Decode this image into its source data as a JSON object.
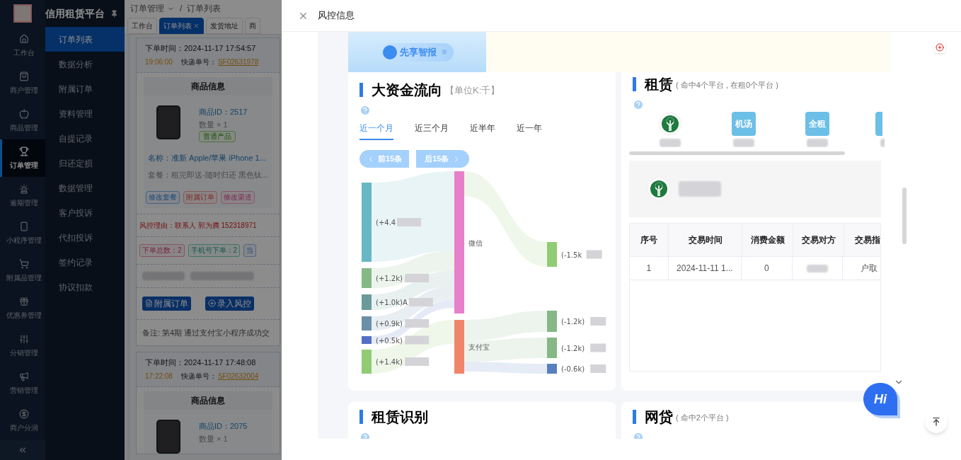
{
  "app": {
    "title": "信用租赁平台"
  },
  "nav": [
    {
      "label": "工作台",
      "selected": false
    },
    {
      "label": "商户管理",
      "selected": false
    },
    {
      "label": "商品管理",
      "selected": false
    },
    {
      "label": "订单管理",
      "selected": true
    },
    {
      "label": "逾期管理",
      "selected": false
    },
    {
      "label": "小程序管理",
      "selected": false
    },
    {
      "label": "附属品管理",
      "selected": false
    },
    {
      "label": "优惠券管理",
      "selected": false
    },
    {
      "label": "分销管理",
      "selected": false
    },
    {
      "label": "营销管理",
      "selected": false
    },
    {
      "label": "商户分润",
      "selected": false
    }
  ],
  "submenu": [
    {
      "label": "订单列表",
      "selected": true
    },
    {
      "label": "数据分析",
      "selected": false
    },
    {
      "label": "附属订单",
      "selected": false
    },
    {
      "label": "资料管理",
      "selected": false
    },
    {
      "label": "自提记录",
      "selected": false
    },
    {
      "label": "归还定损",
      "selected": false
    },
    {
      "label": "数据管理",
      "selected": false
    },
    {
      "label": "客户投诉",
      "selected": false
    },
    {
      "label": "代扣投诉",
      "selected": false
    },
    {
      "label": "签约记录",
      "selected": false
    },
    {
      "label": "协议扣款",
      "selected": false
    }
  ],
  "breadcrumb": {
    "items": [
      "订单管理",
      "订单列表"
    ],
    "separator": "/"
  },
  "tabs": [
    {
      "label": "工作台",
      "selected": false,
      "closable": false
    },
    {
      "label": "订单列表",
      "selected": true,
      "closable": true
    },
    {
      "label": "发货地址",
      "selected": false,
      "closable": false
    },
    {
      "label": "商",
      "selected": false,
      "closable": false
    }
  ],
  "orders": [
    {
      "time_label": "下单时间：",
      "time": "2024-11-17 17:54:57",
      "time2": "19:06:00",
      "express_label": "快递单号：",
      "express": "SF02631978",
      "product_header": "商品信息",
      "product_id": "商品ID：2517",
      "qty": "数量 × 1",
      "tag": "普通产品",
      "name": "名称：准新 Apple/苹果 iPhone 1...",
      "package": "套餐：租完即送-随时归还 黑色钛...",
      "actions": [
        "修改套餐",
        "附属订单",
        "修改渠道"
      ],
      "risk": "风控理由：联系人 郭为腾 152318971",
      "stats": [
        "下单总数：2",
        "手机号下单：2",
        "当"
      ],
      "buttons": [
        "附属订单",
        "录入风控"
      ],
      "note": "备注: 第4期 通过支付宝小程序成功交"
    },
    {
      "time_label": "下单时间：",
      "time": "2024-11-17 17:48:08",
      "time2": "17:22:08",
      "express_label": "快递单号：",
      "express": "SF02632004",
      "product_header": "商品信息",
      "product_id": "商品ID：2075",
      "qty": "数量 × 1"
    }
  ],
  "drawer": {
    "title": "风控信息"
  },
  "report": {
    "brand": "先享智报",
    "fund_flow": {
      "title": "大资金流向",
      "unit": "【单位K:千】",
      "periods": [
        {
          "label": "近一个月",
          "selected": true
        },
        {
          "label": "近三个月",
          "selected": false
        },
        {
          "label": "近半年",
          "selected": false
        },
        {
          "label": "近一年",
          "selected": false
        }
      ],
      "prev": "前15条",
      "next": "后15条",
      "sources": [
        {
          "label": "(+4.4",
          "color": "#67b8c4"
        },
        {
          "label": "(+1.2k)",
          "color": "#86b886"
        },
        {
          "label": "(+1.0k)A",
          "color": "#6b9a9a"
        },
        {
          "label": "(+0.9k)",
          "color": "#6a8fa8"
        },
        {
          "label": "(+0.5k)",
          "color": "#5470c6"
        },
        {
          "label": "(+1.4k)",
          "color": "#91cc75"
        }
      ],
      "hubs": [
        {
          "label": "微信",
          "color": "#e87fcb"
        },
        {
          "label": "支付宝",
          "color": "#f0856a"
        }
      ],
      "targets": [
        {
          "label": "(-1.5k",
          "color": "#91cc75"
        },
        {
          "label": "(-1.2k)",
          "color": "#86b886"
        },
        {
          "label": "(-1.2k)",
          "color": "#86b886"
        },
        {
          "label": "(-0.6k)",
          "color": "#5a7fc0"
        }
      ]
    },
    "rental": {
      "title": "租赁",
      "summary": "( 命中4个平台 , 在租0个平台 )",
      "platforms": [
        {
          "kind": "logo"
        },
        {
          "kind": "tile",
          "label": "机汤"
        },
        {
          "kind": "tile",
          "label": "全租"
        },
        {
          "kind": "partial"
        }
      ],
      "columns": [
        "序号",
        "交易时间",
        "消费金额",
        "交易对方",
        "交易指"
      ],
      "rows": [
        {
          "index": "1",
          "time": "2024-11-11 1...",
          "amount": "0",
          "detail": "户取"
        }
      ]
    },
    "rental_id": {
      "title": "租赁识别"
    },
    "loan": {
      "title": "网贷",
      "summary": "( 命中2个平台 )"
    }
  },
  "chat": {
    "label": "Hi"
  }
}
